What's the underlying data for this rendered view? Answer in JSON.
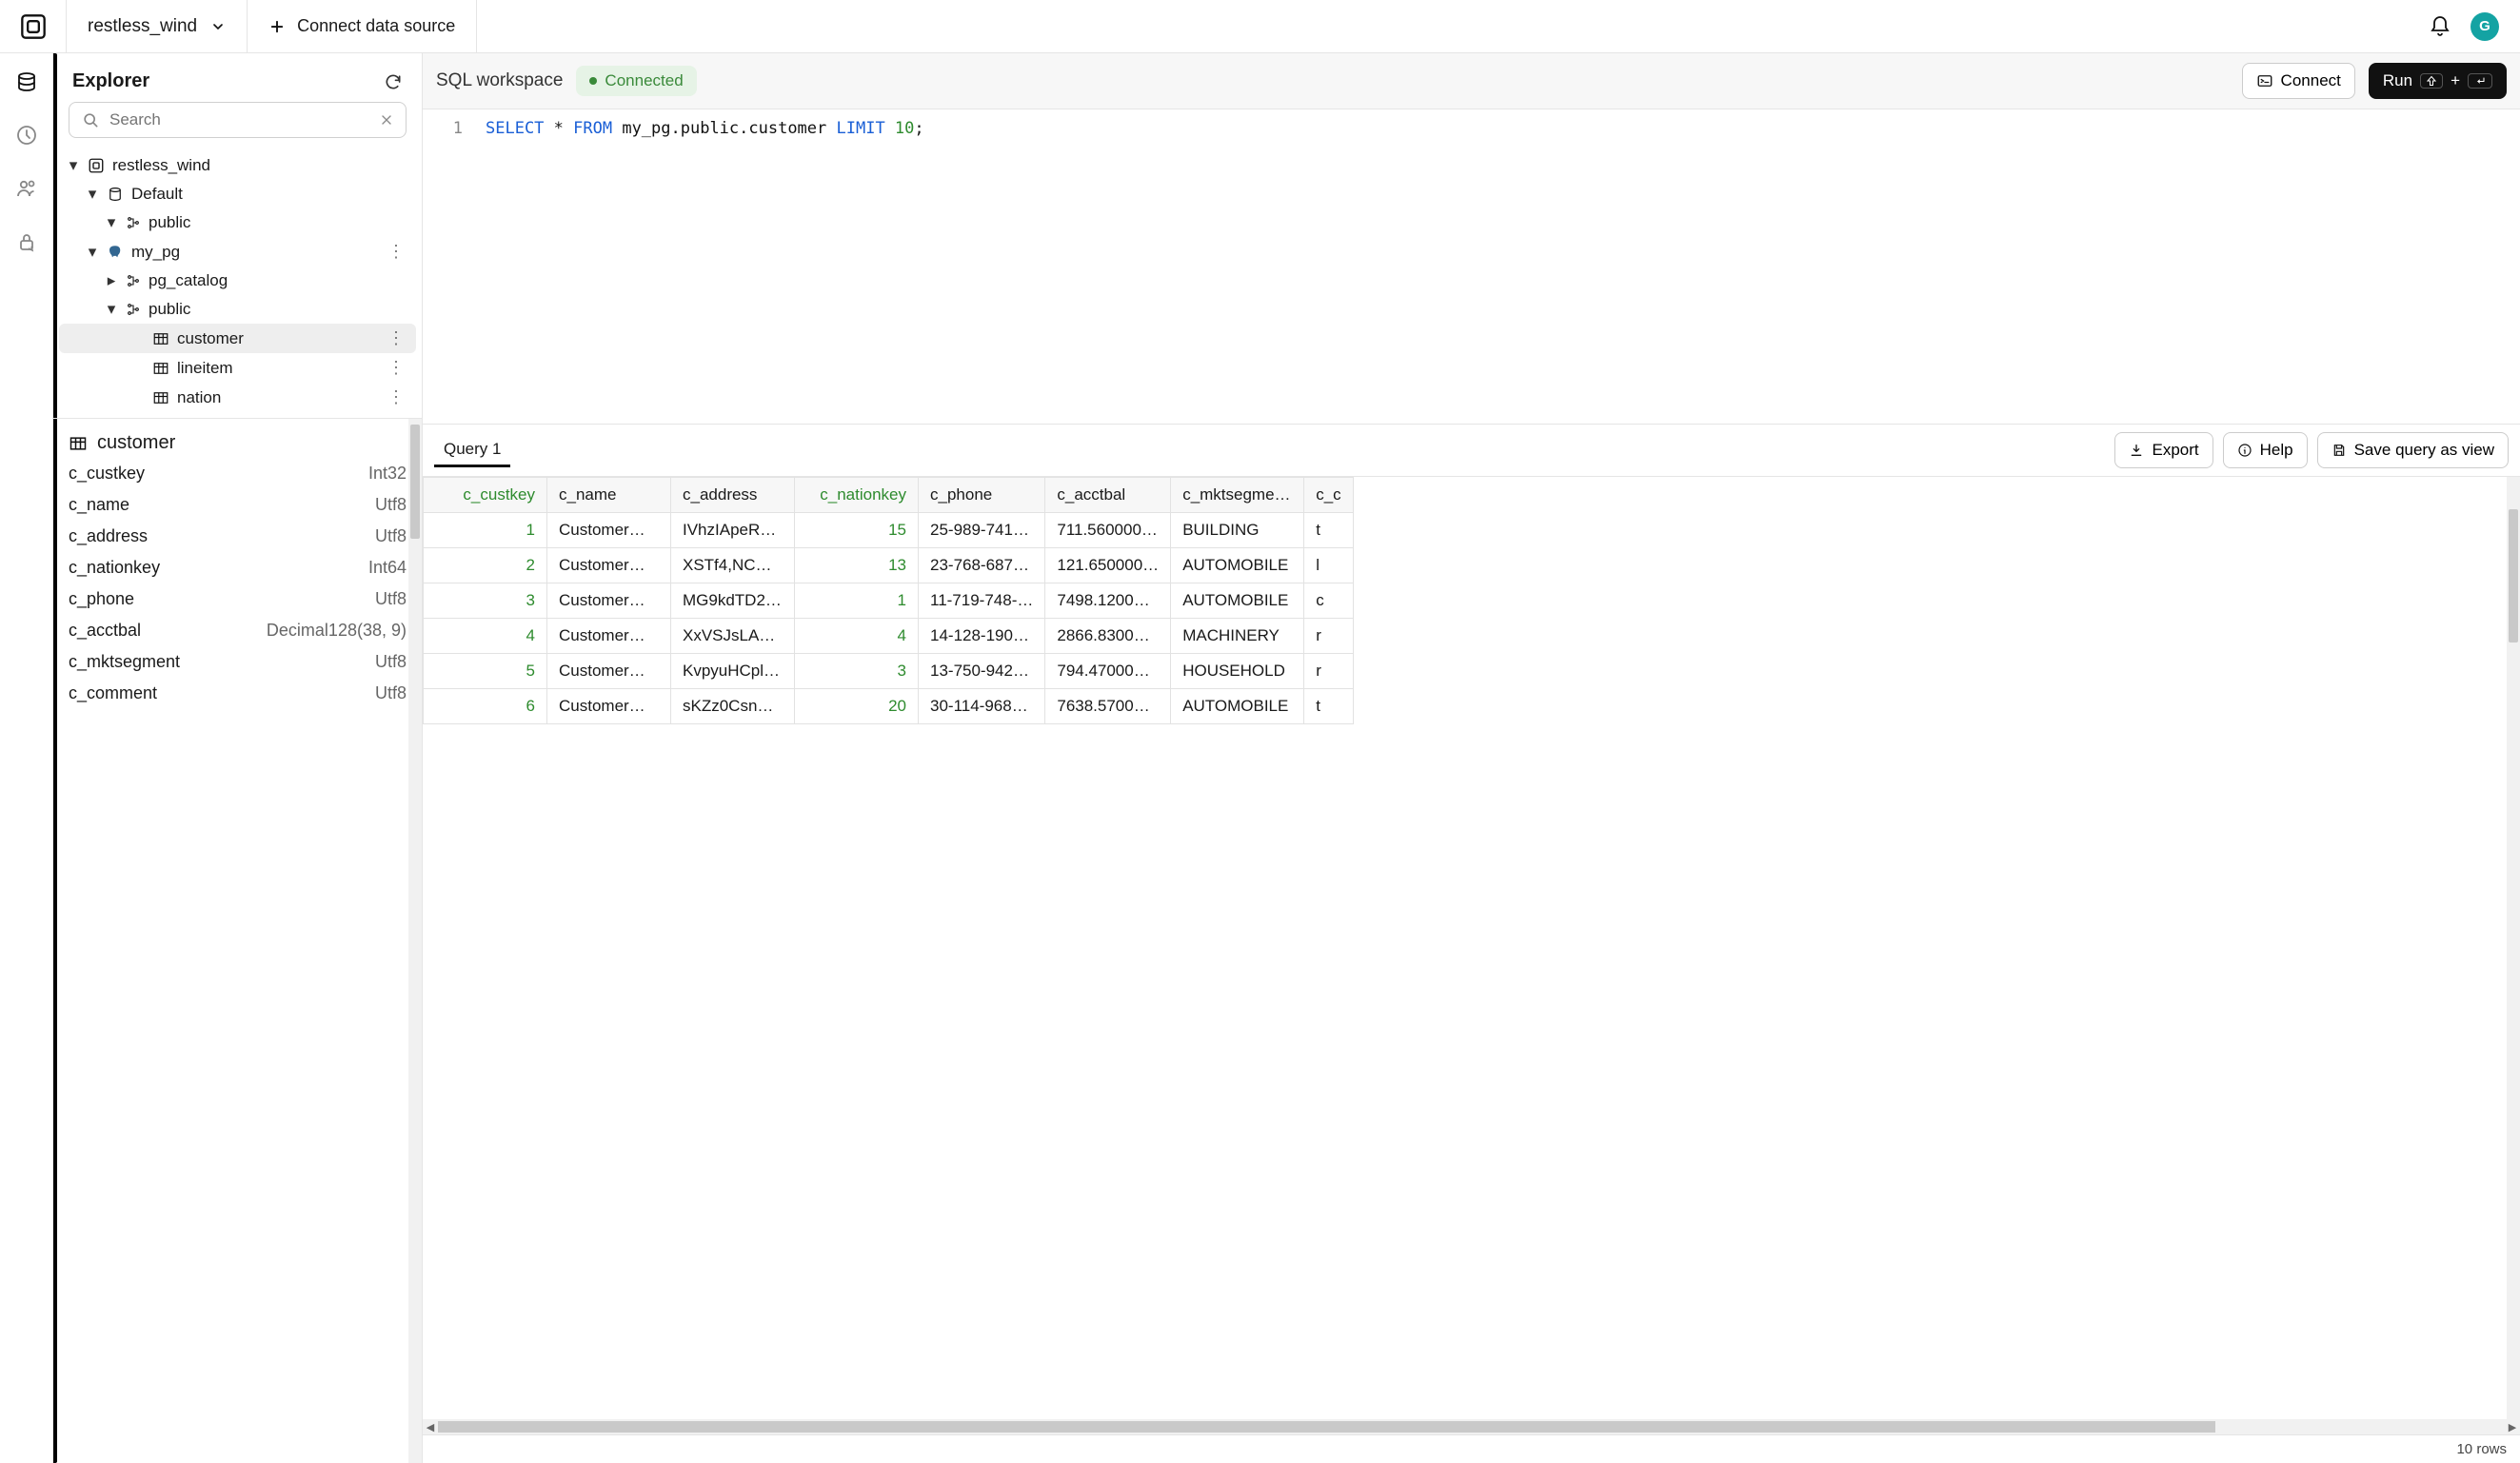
{
  "topbar": {
    "project_name": "restless_wind",
    "connect_label": "Connect data source",
    "avatar_initial": "G"
  },
  "explorer": {
    "title": "Explorer",
    "search_placeholder": "Search",
    "tree": {
      "root": "restless_wind",
      "default_db": "Default",
      "default_schema": "public",
      "my_pg": "my_pg",
      "pg_catalog": "pg_catalog",
      "my_pg_public": "public",
      "tables": {
        "customer": "customer",
        "lineitem": "lineitem",
        "nation": "nation"
      }
    }
  },
  "details": {
    "table_name": "customer",
    "columns": [
      {
        "name": "c_custkey",
        "type": "Int32"
      },
      {
        "name": "c_name",
        "type": "Utf8"
      },
      {
        "name": "c_address",
        "type": "Utf8"
      },
      {
        "name": "c_nationkey",
        "type": "Int64"
      },
      {
        "name": "c_phone",
        "type": "Utf8"
      },
      {
        "name": "c_acctbal",
        "type": "Decimal128(38, 9)"
      },
      {
        "name": "c_mktsegment",
        "type": "Utf8"
      },
      {
        "name": "c_comment",
        "type": "Utf8"
      }
    ]
  },
  "workspace": {
    "title": "SQL workspace",
    "status": "Connected",
    "connect_btn": "Connect",
    "run_btn": "Run"
  },
  "editor": {
    "line_no": "1",
    "tokens": {
      "select": "SELECT",
      "star": " * ",
      "from": "FROM",
      "table": " my_pg.public.customer ",
      "limit": "LIMIT",
      "n": " 10",
      "semi": ";"
    }
  },
  "results": {
    "tab_label": "Query 1",
    "export_btn": "Export",
    "help_btn": "Help",
    "save_view_btn": "Save query as view",
    "row_count_label": "10 rows",
    "columns": [
      {
        "key": "c_custkey",
        "label": "c_custkey",
        "w": 130,
        "align": "num"
      },
      {
        "key": "c_name",
        "label": "c_name",
        "w": 130,
        "align": ""
      },
      {
        "key": "c_address",
        "label": "c_address",
        "w": 130,
        "align": ""
      },
      {
        "key": "c_nationkey",
        "label": "c_nationkey",
        "w": 130,
        "align": "num"
      },
      {
        "key": "c_phone",
        "label": "c_phone",
        "w": 130,
        "align": ""
      },
      {
        "key": "c_acctbal",
        "label": "c_acctbal",
        "w": 130,
        "align": ""
      },
      {
        "key": "c_mktsegment",
        "label": "c_mktsegme…",
        "w": 140,
        "align": ""
      },
      {
        "key": "c_comment",
        "label": "c_c",
        "w": 40,
        "align": ""
      }
    ],
    "rows": [
      {
        "c_custkey": "1",
        "c_name": "Customer…",
        "c_address": "IVhzIApeR…",
        "c_nationkey": "15",
        "c_phone": "25-989-741…",
        "c_acctbal": "711.560000…",
        "c_mktsegment": "BUILDING",
        "c_comment": "t"
      },
      {
        "c_custkey": "2",
        "c_name": "Customer…",
        "c_address": "XSTf4,NC…",
        "c_nationkey": "13",
        "c_phone": "23-768-687…",
        "c_acctbal": "121.650000…",
        "c_mktsegment": "AUTOMOBILE",
        "c_comment": "l"
      },
      {
        "c_custkey": "3",
        "c_name": "Customer…",
        "c_address": "MG9kdTD2…",
        "c_nationkey": "1",
        "c_phone": "11-719-748-…",
        "c_acctbal": "7498.1200…",
        "c_mktsegment": "AUTOMOBILE",
        "c_comment": "c"
      },
      {
        "c_custkey": "4",
        "c_name": "Customer…",
        "c_address": "XxVSJsLA…",
        "c_nationkey": "4",
        "c_phone": "14-128-190…",
        "c_acctbal": "2866.8300…",
        "c_mktsegment": "MACHINERY",
        "c_comment": "r"
      },
      {
        "c_custkey": "5",
        "c_name": "Customer…",
        "c_address": "KvpyuHCpl…",
        "c_nationkey": "3",
        "c_phone": "13-750-942…",
        "c_acctbal": "794.47000…",
        "c_mktsegment": "HOUSEHOLD",
        "c_comment": "r"
      },
      {
        "c_custkey": "6",
        "c_name": "Customer…",
        "c_address": "sKZz0Csn…",
        "c_nationkey": "20",
        "c_phone": "30-114-968…",
        "c_acctbal": "7638.5700…",
        "c_mktsegment": "AUTOMOBILE",
        "c_comment": "t"
      }
    ]
  }
}
